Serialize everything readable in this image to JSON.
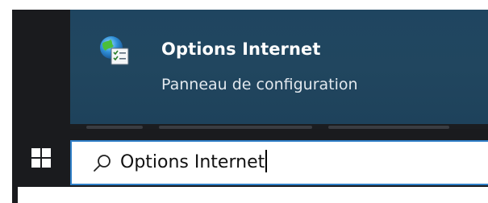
{
  "search_result": {
    "title": "Options Internet",
    "subtitle": "Panneau de configuration",
    "icon": "internet-options-icon"
  },
  "taskbar": {
    "start_icon": "windows-logo-icon",
    "search": {
      "icon": "search-icon",
      "value": "Options Internet"
    }
  },
  "colors": {
    "panel_background": "#1b1d20",
    "result_highlight": "#21465f",
    "taskbar_background": "#1a1b1e",
    "search_border": "#2f7fc8"
  }
}
